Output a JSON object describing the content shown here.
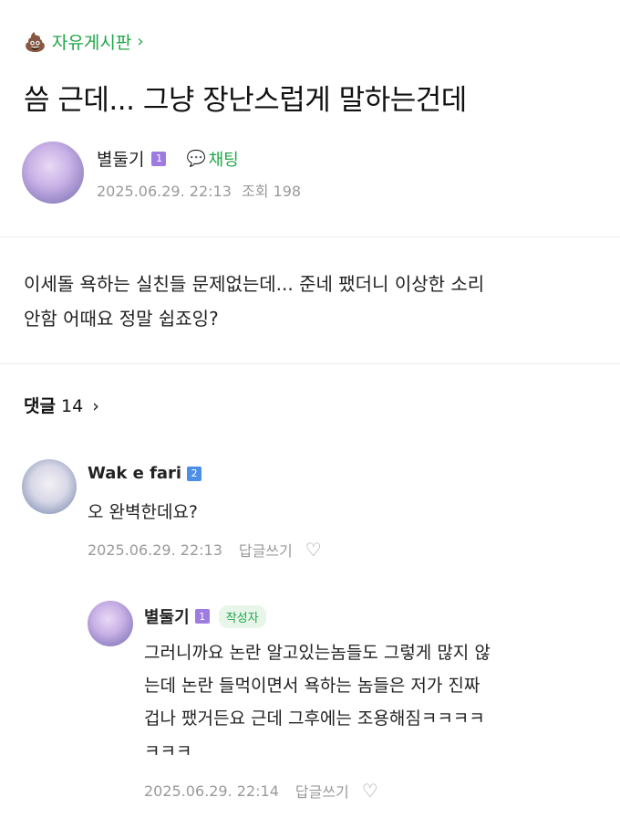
{
  "board": {
    "icon": "poop-icon",
    "name": "자유게시판",
    "chevron": "›"
  },
  "post": {
    "title": "씀 근데... 그냥 장난스럽게 말하는건데",
    "author": "별둘기",
    "level": "1",
    "chat_label": "채팅",
    "date": "2025.06.29. 22:13",
    "views_label": "조회",
    "views": "198",
    "body_line1": "이세돌 욕하는 실친들 문제없는데... 준네 팼더니 이상한 소리",
    "body_line2": "안함 어때요 정말 쉽죠잉?"
  },
  "comments_header": {
    "label": "댓글",
    "count": "14",
    "chevron": "›"
  },
  "comments": [
    {
      "author": "Wak e fari",
      "level": "2",
      "text": "오 완벽한데요?",
      "date": "2025.06.29. 22:13",
      "reply_label": "답글쓰기"
    },
    {
      "author": "별둘기",
      "level": "1",
      "badge": "작성자",
      "text_lines": [
        "그러니까요 논란 알고있는놈들도 그렇게 많지 않",
        "는데 논란 들먹이면서 욕하는 놈들은 저가 진짜",
        "겁나 팼거든요 근데 그후에는 조용해짐ㅋㅋㅋㅋ",
        "ㅋㅋㅋ"
      ],
      "date": "2025.06.29. 22:14",
      "reply_label": "답글쓰기"
    }
  ],
  "colors": {
    "accent": "#1fa64a",
    "meta": "#9a9a9a",
    "level1": "#9d7be0",
    "level2": "#4d8ee8"
  }
}
